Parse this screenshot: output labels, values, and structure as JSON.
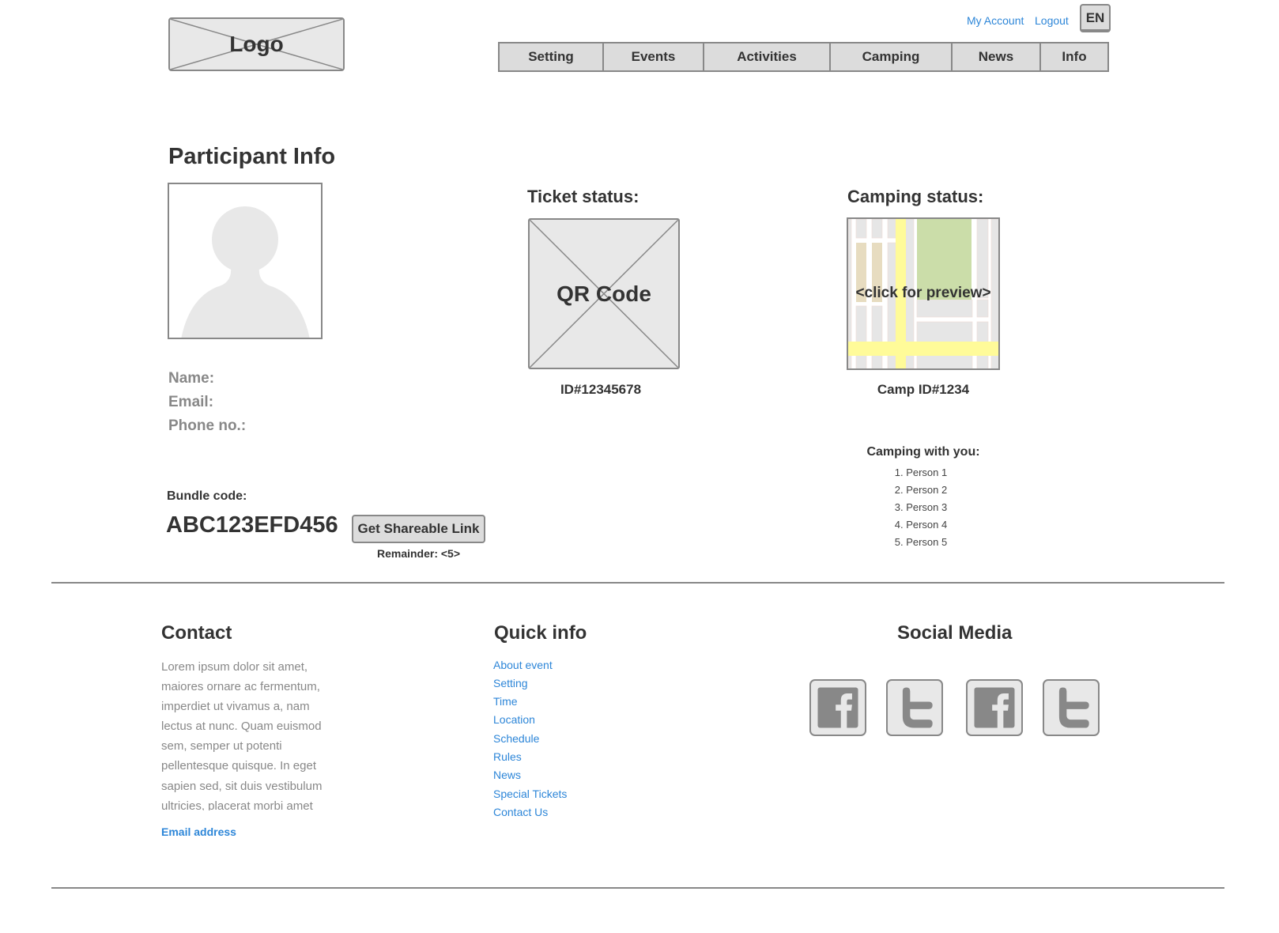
{
  "header": {
    "logo": "Logo",
    "my_account": "My Account",
    "logout": "Logout",
    "language": "EN",
    "nav": [
      "Setting",
      "Events",
      "Activities",
      "Camping",
      "News",
      "Info"
    ]
  },
  "participant": {
    "title": "Participant Info",
    "name_label": "Name:",
    "email_label": "Email:",
    "phone_label": "Phone no.:",
    "bundle_label": "Bundle code:",
    "bundle_code": "ABC123EFD456",
    "share_button": "Get Shareable Link",
    "remainder": "Remainder: <5>"
  },
  "ticket": {
    "title": "Ticket status:",
    "qr_label": "QR Code",
    "id": "ID#12345678"
  },
  "camping": {
    "title": "Camping status:",
    "map_label": "<click for preview>",
    "camp_id": "Camp ID#1234",
    "with_title": "Camping with you:",
    "people": [
      "1. Person 1",
      "2. Person 2",
      "3. Person 3",
      "4. Person 4",
      "5. Person 5"
    ]
  },
  "footer": {
    "contact_title": "Contact",
    "contact_text": "Lorem ipsum dolor sit amet, maiores ornare ac fermentum, imperdiet ut vivamus a, nam lectus at nunc. Quam euismod sem, semper ut potenti pellentesque quisque. In eget sapien sed, sit duis vestibulum ultricies, placerat morbi amet",
    "email_link": "Email address",
    "quick_title": "Quick info",
    "quick_links": [
      "About event",
      "Setting",
      "Time",
      "Location",
      "Schedule",
      "Rules",
      "News",
      "Special Tickets",
      "Contact Us"
    ],
    "social_title": "Social Media",
    "social_icons": [
      "facebook-icon",
      "twitter-icon",
      "facebook-icon",
      "twitter-icon"
    ]
  },
  "colors": {
    "link": "#2d86d8",
    "border": "#888888",
    "placeholder": "#e8e8e8"
  }
}
